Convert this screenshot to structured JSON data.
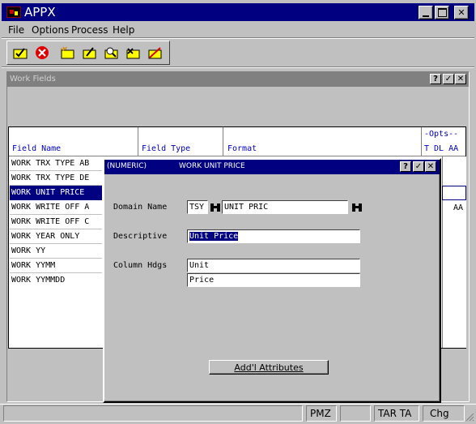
{
  "app": {
    "title": "APPX"
  },
  "menu": {
    "items": [
      "File",
      "Options",
      "Process",
      "Help"
    ]
  },
  "toolbar": {
    "icons": [
      "check-folder-icon",
      "cancel-icon",
      "new-record-icon",
      "edit-record-icon",
      "inquire-record-icon",
      "delete-record-icon",
      "cancel-record-icon"
    ]
  },
  "work_fields": {
    "title": "Work Fields",
    "headers": {
      "field_name": "Field Name",
      "field_type": "Field Type",
      "format": "Format",
      "opts": "-Opts--",
      "opts_cols": "T DL AA"
    },
    "rows": [
      {
        "name": "WORK TRX TYPE AB",
        "aa": ""
      },
      {
        "name": "WORK TRX TYPE DE",
        "aa": ""
      },
      {
        "name": "WORK UNIT PRICE",
        "aa": ""
      },
      {
        "name": "WORK WRITE OFF A",
        "aa": "AA"
      },
      {
        "name": "WORK WRITE OFF C",
        "aa": ""
      },
      {
        "name": "WORK YEAR ONLY",
        "aa": ""
      },
      {
        "name": "WORK YY",
        "aa": ""
      },
      {
        "name": "WORK YYMM",
        "aa": ""
      },
      {
        "name": "WORK YYMMDD",
        "aa": ""
      }
    ]
  },
  "dialog": {
    "type_label": "(NUMERIC)",
    "title": "WORK UNIT PRICE",
    "domain_label": "Domain Name",
    "domain_app": "TSY",
    "domain_value": "UNIT PRIC",
    "desc_label": "Descriptive",
    "desc_value": "Unit Price",
    "colhdg_label": "Column Hdgs",
    "colhdg_1": "Unit",
    "colhdg_2": "Price",
    "button": "Add'l Attributes"
  },
  "status": {
    "cells": [
      "PMZ",
      "TAR TA",
      "Chg"
    ]
  },
  "colors": {
    "titlebar": "#000080",
    "header_text": "#0000c0",
    "selection": "#000080"
  }
}
